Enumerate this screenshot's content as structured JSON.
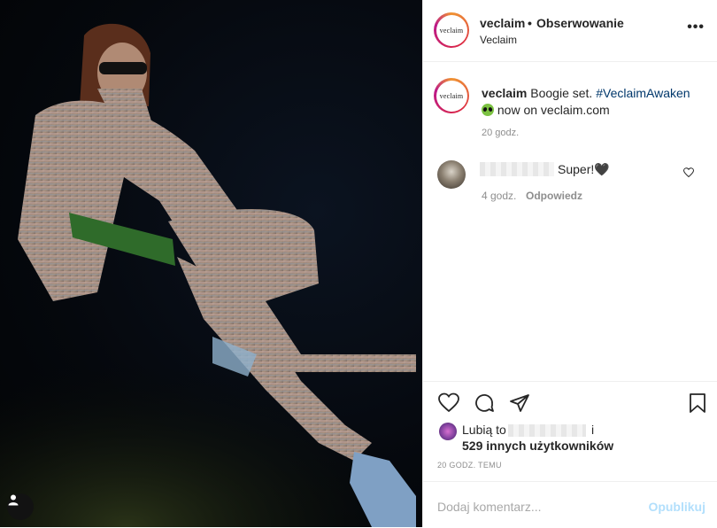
{
  "account": {
    "avatar_text": "veclaim",
    "username": "veclaim",
    "separator": "•",
    "follow_status": "Obserwowanie",
    "location": "Veclaim",
    "more_label": "•••"
  },
  "caption": {
    "username": "veclaim",
    "text": "Boogie set.",
    "hashtag": "#VeclaimAwaken",
    "emoji_icon": "alien-icon",
    "text2": "now on veclaim.com",
    "time": "20 godz."
  },
  "comment": {
    "text": "Super!🖤",
    "time": "4 godz.",
    "reply": "Odpowiedz"
  },
  "likes": {
    "prefix": "Lubią to",
    "and": "i",
    "others": "529 innych użytkowników"
  },
  "post_time": "20 GODZ. TEMU",
  "add_comment": {
    "placeholder": "Dodaj komentarz...",
    "publish": "Opublikuj"
  },
  "colors": {
    "link": "#00376b",
    "secondary_text": "#8e8e8e",
    "publish_disabled": "#b2dffc"
  }
}
